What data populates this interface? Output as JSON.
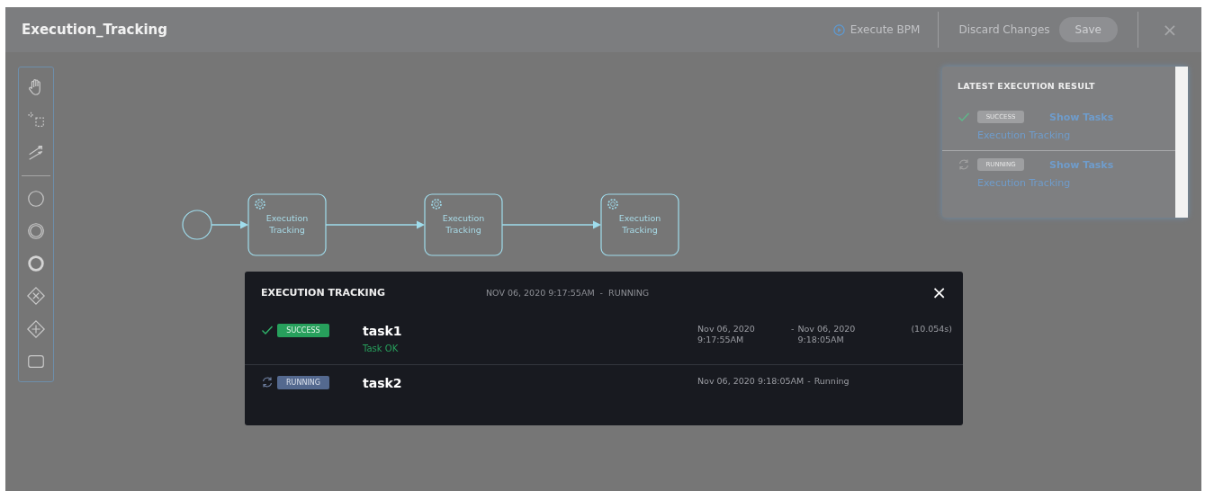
{
  "header": {
    "title": "Execution_Tracking",
    "execute_label": "Execute BPM",
    "discard_label": "Discard Changes",
    "save_label": "Save",
    "close_label": "×"
  },
  "toolbar": {
    "tools": [
      {
        "kind": "hand"
      },
      {
        "kind": "marquee"
      },
      {
        "kind": "connect"
      },
      {
        "kind": "divider"
      },
      {
        "kind": "start"
      },
      {
        "kind": "intermediate"
      },
      {
        "kind": "end"
      },
      {
        "kind": "xor"
      },
      {
        "kind": "and"
      },
      {
        "kind": "task"
      }
    ]
  },
  "diagram": {
    "nodes": [
      {
        "kind": "start"
      },
      {
        "kind": "task",
        "label": "Execution Tracking"
      },
      {
        "kind": "task",
        "label": "Execution Tracking"
      },
      {
        "kind": "task",
        "label": "Execution Tracking"
      }
    ]
  },
  "latest_results": {
    "title": "LATEST EXECUTION RESULT",
    "items": [
      {
        "kind": "success",
        "badge": "SUCCESS",
        "action": "Show Tasks",
        "name": "Execution Tracking"
      },
      {
        "kind": "running",
        "badge": "RUNNING",
        "action": "Show Tasks",
        "name": "Execution Tracking"
      }
    ]
  },
  "tracking": {
    "title": "EXECUTION TRACKING",
    "summary": "NOV 06, 2020 9:17:55AM  -  RUNNING",
    "close_label": "×",
    "tasks": [
      {
        "kind": "success",
        "badge": "SUCCESS",
        "name": "task1",
        "message": "Task OK",
        "start": "Nov 06, 2020 9:17:55AM",
        "separator": "-",
        "end": "Nov 06, 2020 9:18:05AM",
        "duration": "(10.054s)"
      },
      {
        "kind": "running",
        "badge": "RUNNING",
        "name": "task2",
        "start": "Nov 06, 2020 9:18:05AM",
        "separator": "-",
        "end_note": "Running"
      }
    ]
  }
}
